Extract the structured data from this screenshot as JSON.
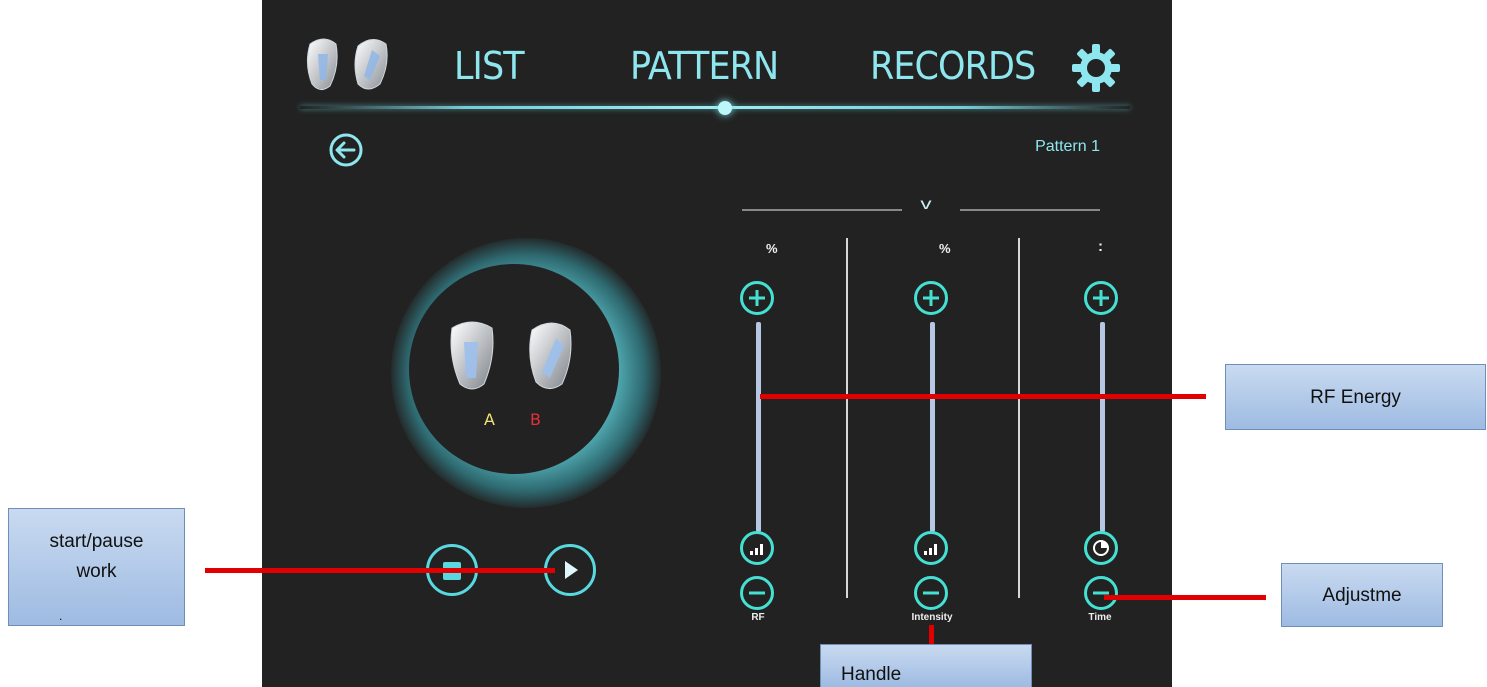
{
  "nav": {
    "items": [
      {
        "label": "LIST"
      },
      {
        "label": "PATTERN"
      },
      {
        "label": "RECORDS"
      }
    ]
  },
  "header": {
    "pattern_title": "Pattern 1"
  },
  "handles": {
    "label_a": "A",
    "label_b": "B"
  },
  "controls": {
    "columns": [
      {
        "unit": "%",
        "caption": "RF"
      },
      {
        "unit": "%",
        "caption": "Intensity"
      },
      {
        "unit": ":",
        "caption": "Time"
      }
    ]
  },
  "annotations": {
    "rf_energy": "RF Energy",
    "adjustment": "Adjustme",
    "start_pause": "start/pause work",
    "start_pause_dot": ".",
    "handle": "Handle"
  },
  "colors": {
    "accent": "#8ee6ee",
    "button_ring": "#45e0d2",
    "label_a": "#f2e27a",
    "label_b": "#e0323a",
    "annotation_line": "#e00000"
  }
}
